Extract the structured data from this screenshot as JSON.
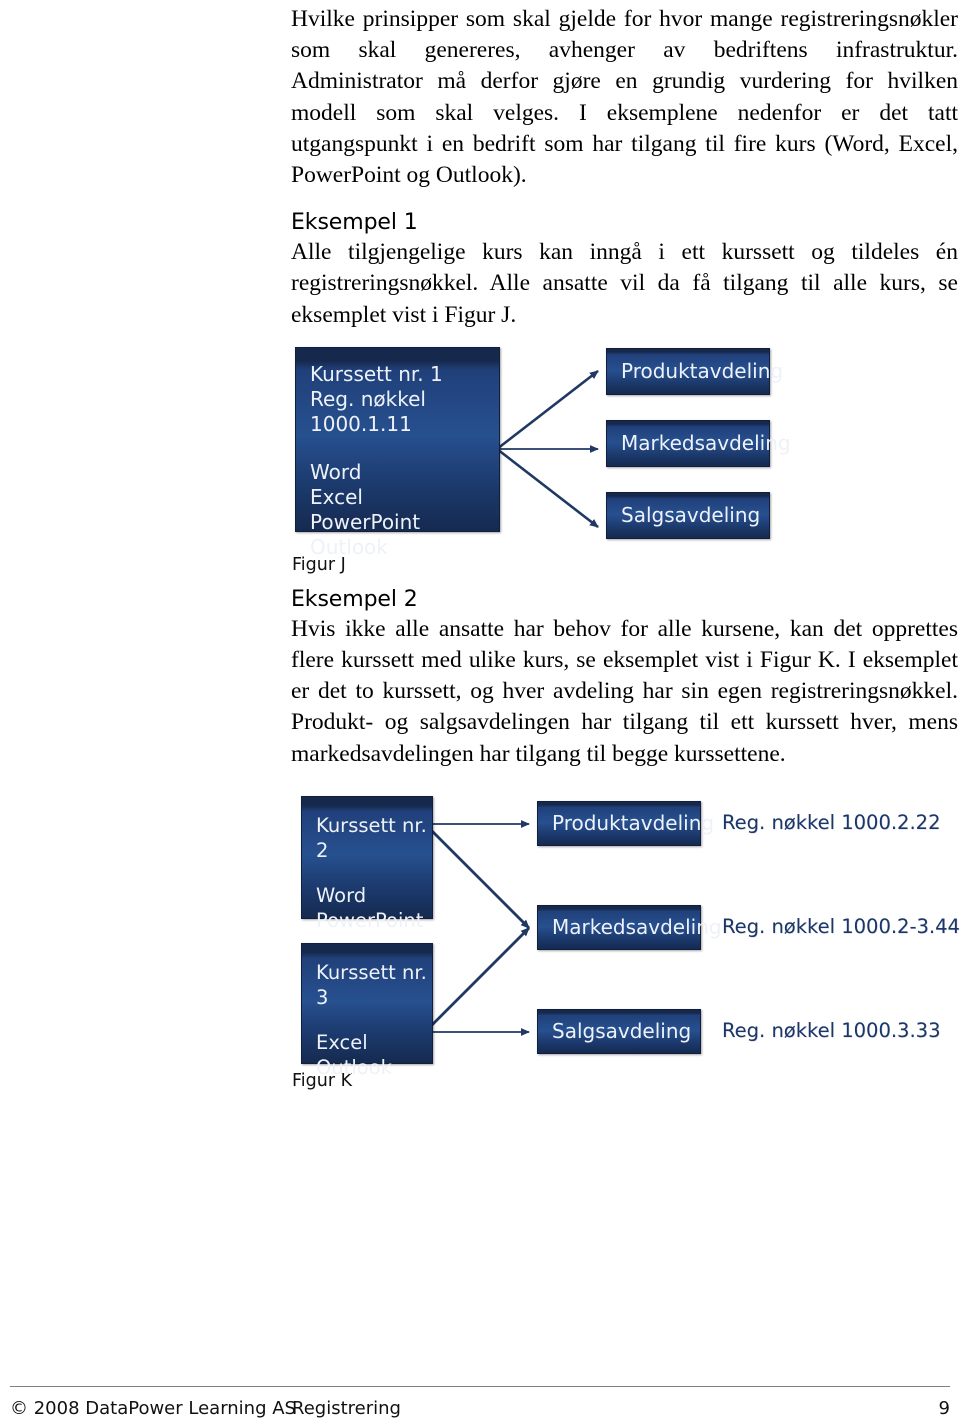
{
  "document": {
    "intro_paragraph": "Hvilke prinsipper som skal gjelde for hvor mange registreringsnøkler som skal genereres, avhenger av bedriftens infrastruktur. Administrator må derfor gjøre en grundig vurdering for hvilken modell som skal velges. I eksemplene nedenfor er det tatt utgangspunkt i en bedrift som har tilgang til fire kurs (Word, Excel, PowerPoint og Outlook).",
    "sections": [
      {
        "heading": "Eksempel 1",
        "paragraph": "Alle tilgjengelige kurs kan inngå i ett kurssett og tildeles én registreringsnøkkel. Alle ansatte vil da få tilgang til alle kurs, se eksemplet vist i Figur J."
      },
      {
        "heading": "Eksempel 2",
        "paragraph": "Hvis ikke alle ansatte har behov for alle kursene, kan det opprettes flere kurssett med ulike kurs, se eksemplet vist i Figur K. I eksemplet er det to kurssett, og hver avdeling har sin egen registreringsnøkkel. Produkt- og salgsavdelingen har tilgang til ett kurssett hver, mens markedsavdelingen har tilgang til begge kurssettene."
      }
    ]
  },
  "figure_j": {
    "caption": "Figur J",
    "course_set": {
      "title": "Kurssett nr. 1",
      "reg_key": "Reg. nøkkel 1000.1.11",
      "courses": "Word\nExcel\nPowerPoint\nOutlook"
    },
    "departments": [
      {
        "label": "Produktavdeling"
      },
      {
        "label": "Markedsavdeling"
      },
      {
        "label": "Salgsavdeling"
      }
    ]
  },
  "figure_k": {
    "caption": "Figur K",
    "course_sets": [
      {
        "title": "Kurssett nr. 2",
        "courses": "Word\nPowerPoint"
      },
      {
        "title": "Kurssett nr. 3",
        "courses": "Excel\nOutlook"
      }
    ],
    "departments": [
      {
        "label": "Produktavdeling",
        "reg_key": "Reg. nøkkel 1000.2.22"
      },
      {
        "label": "Markedsavdeling",
        "reg_key": "Reg. nøkkel 1000.2-3.44"
      },
      {
        "label": "Salgsavdeling",
        "reg_key": "Reg. nøkkel 1000.3.33"
      }
    ]
  },
  "footer": {
    "copyright": "© 2008 DataPower Learning AS",
    "section": "Registrering",
    "page_number": "9"
  },
  "colors": {
    "node_fill": "#1d3666",
    "node_fill_dark": "#16294d",
    "node_text": "#eef2f8",
    "reg_key_text": "#1b3668",
    "arrow": "#1f3864",
    "page_background": "#ffffff"
  }
}
